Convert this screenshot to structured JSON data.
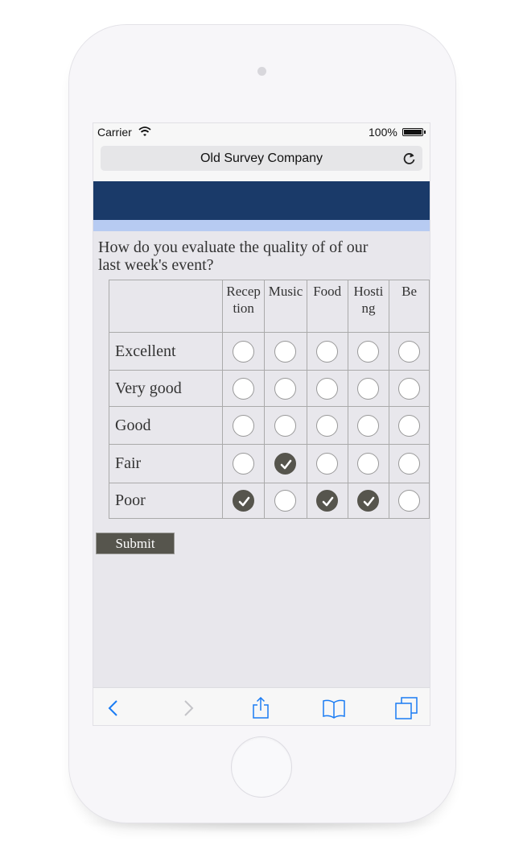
{
  "status_bar": {
    "carrier": "Carrier",
    "battery": "100%"
  },
  "browser": {
    "title": "Old Survey Company"
  },
  "survey": {
    "question": "How do you evaluate the quality of of our last week's event?",
    "columns": [
      "Recep tion",
      "Music",
      "Food",
      "Hosti ng",
      "Be"
    ],
    "rows": [
      {
        "label": "Excellent",
        "selected": [
          false,
          false,
          false,
          false,
          false
        ]
      },
      {
        "label": "Very good",
        "selected": [
          false,
          false,
          false,
          false,
          false
        ]
      },
      {
        "label": "Good",
        "selected": [
          false,
          false,
          false,
          false,
          false
        ]
      },
      {
        "label": "Fair",
        "selected": [
          false,
          true,
          false,
          false,
          false
        ]
      },
      {
        "label": "Poor",
        "selected": [
          true,
          false,
          true,
          true,
          false
        ]
      }
    ],
    "submit_label": "Submit"
  },
  "colors": {
    "header_dark": "#1a3a69",
    "header_light": "#b7cbf2",
    "accent": "#56554d",
    "toolbar_blue": "#1a7cf4"
  },
  "icons": [
    "wifi-icon",
    "battery-icon",
    "reload-icon",
    "back-icon",
    "forward-icon",
    "share-icon",
    "bookmarks-icon",
    "tabs-icon"
  ]
}
